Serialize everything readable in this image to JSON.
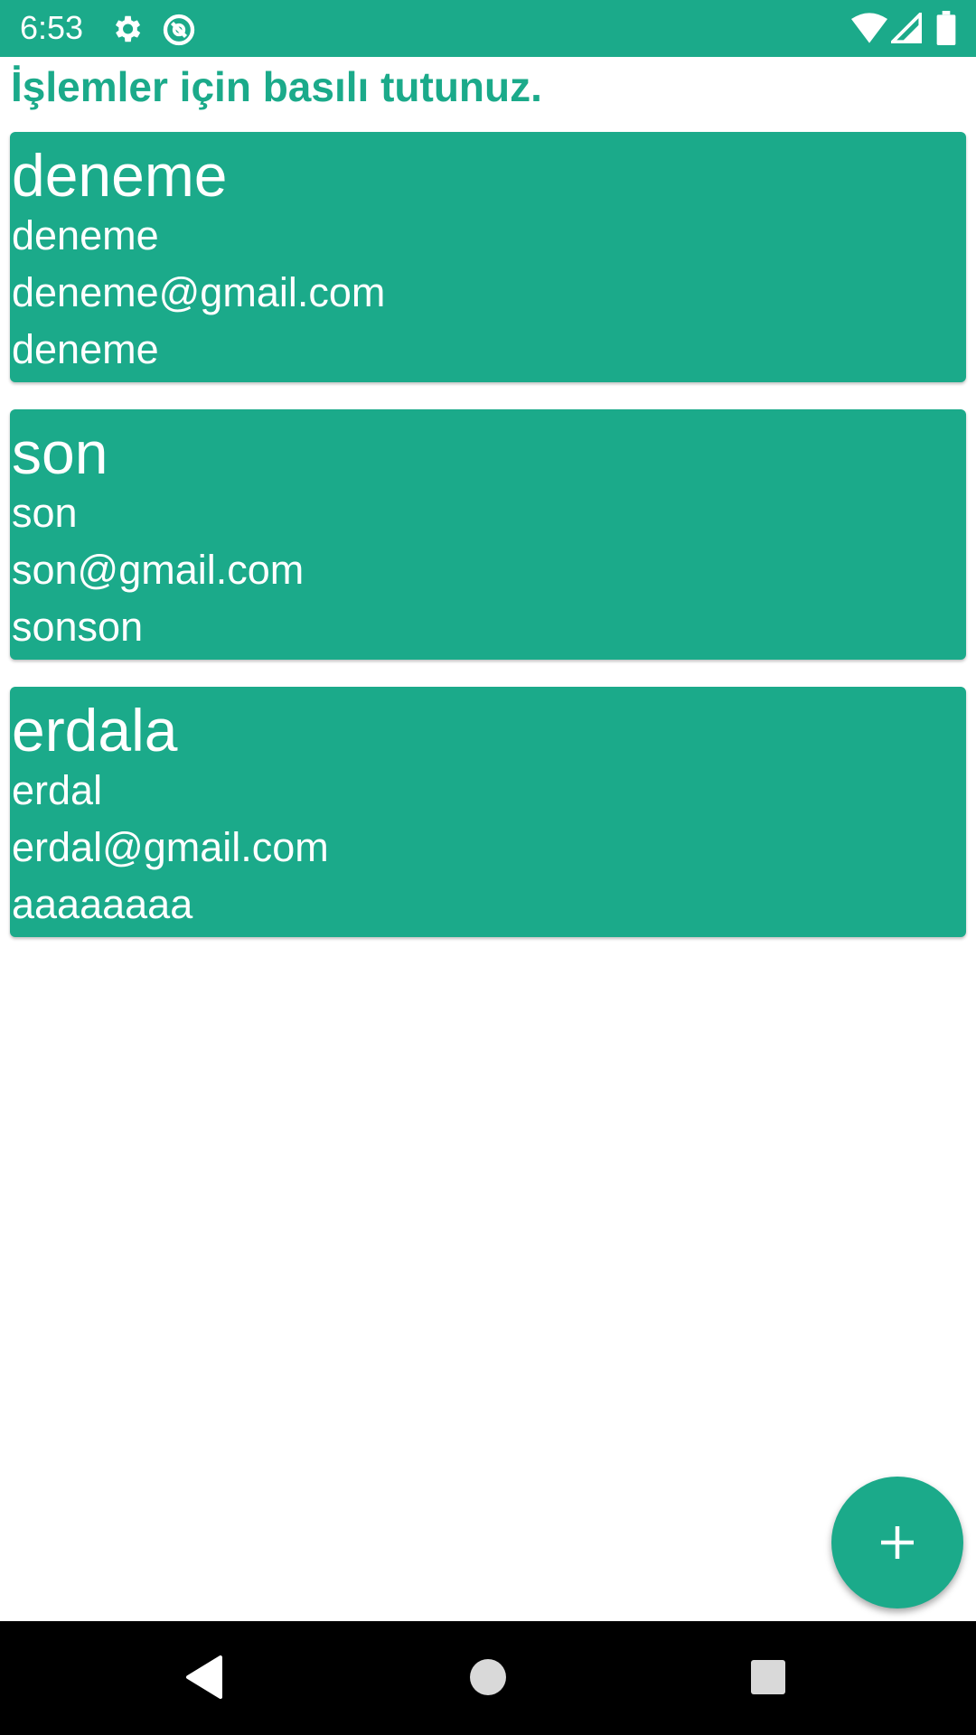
{
  "status_bar": {
    "time": "6:53",
    "icons": [
      "gear-icon",
      "do-not-disturb-icon",
      "wifi-icon",
      "signal-icon",
      "battery-icon"
    ]
  },
  "hint": "İşlemler için basılı tutunuz.",
  "cards": [
    {
      "title": "deneme",
      "line1": "deneme",
      "line2": "deneme@gmail.com",
      "line3": "deneme"
    },
    {
      "title": "son",
      "line1": "son",
      "line2": "son@gmail.com",
      "line3": "sonson"
    },
    {
      "title": "erdala",
      "line1": "erdal",
      "line2": "erdal@gmail.com",
      "line3": "aaaaaaaa"
    }
  ],
  "fab": {
    "icon": "plus-icon"
  },
  "nav_bar": {
    "icons": [
      "back-icon",
      "home-icon",
      "recents-icon"
    ]
  },
  "colors": {
    "accent": "#1BAA8A",
    "nav_background": "#000000",
    "text_on_accent": "#FFFFFF"
  }
}
